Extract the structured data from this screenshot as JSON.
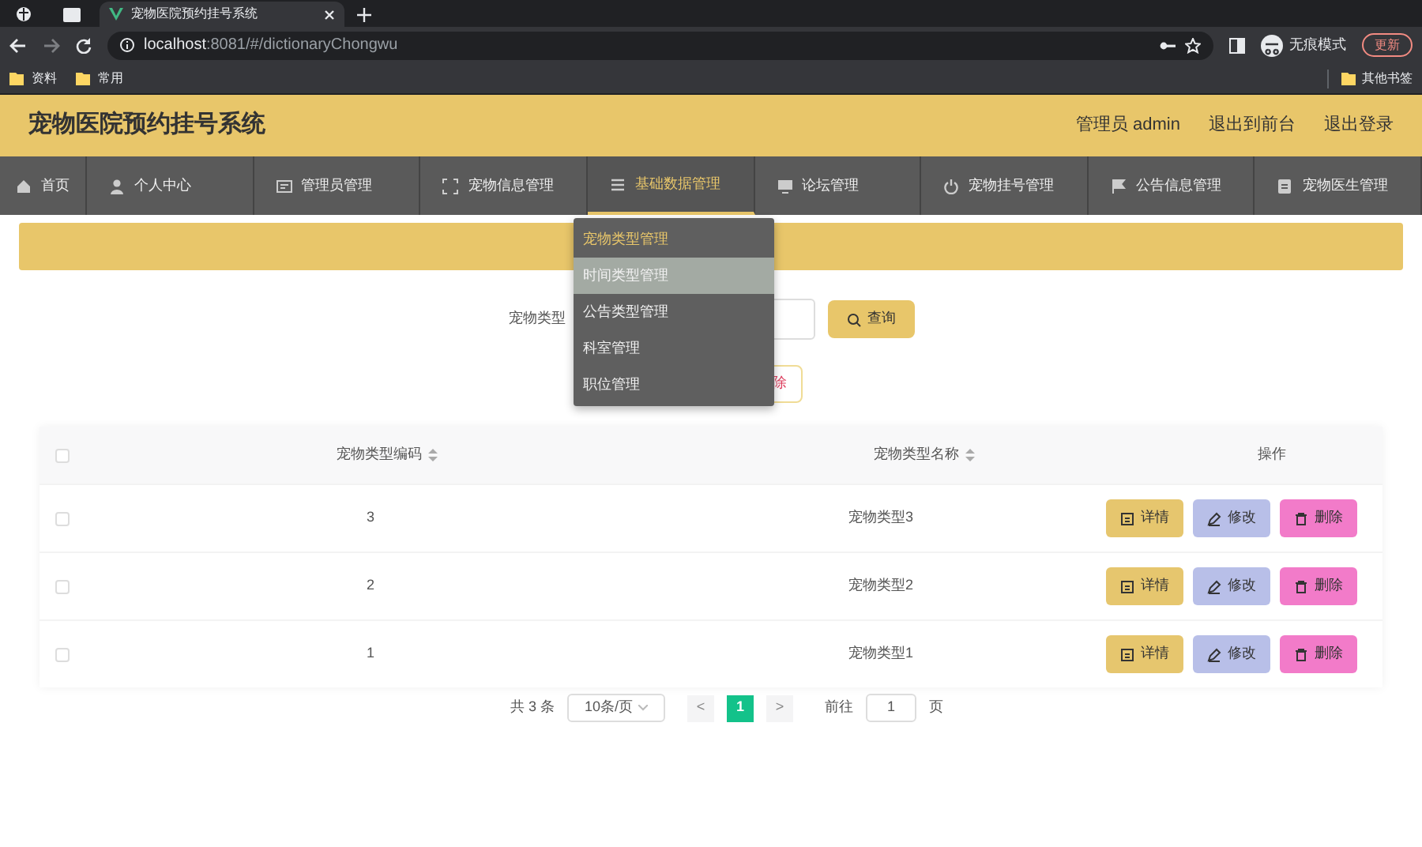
{
  "browser": {
    "tab_title": "宠物医院预约挂号系统",
    "url_host": "localhost",
    "url_rest": ":8081/#/dictionaryChongwu",
    "profile": "无痕模式",
    "update": "更新",
    "bookmarks": [
      "资料",
      "常用"
    ],
    "other_bookmarks": "其他书签"
  },
  "header": {
    "title": "宠物医院预约挂号系统",
    "user": "管理员 admin",
    "links": [
      "退出到前台",
      "退出登录"
    ]
  },
  "nav": [
    {
      "label": "首页",
      "kind": "home",
      "selected": false
    },
    {
      "label": "个人中心",
      "kind": "user",
      "selected": false
    },
    {
      "label": "管理员管理",
      "kind": "card",
      "selected": false
    },
    {
      "label": "宠物信息管理",
      "kind": "frame",
      "selected": false
    },
    {
      "label": "基础数据管理",
      "kind": "list",
      "selected": true
    },
    {
      "label": "论坛管理",
      "kind": "monitor",
      "selected": false
    },
    {
      "label": "宠物挂号管理",
      "kind": "power",
      "selected": false
    },
    {
      "label": "公告信息管理",
      "kind": "flag",
      "selected": false
    },
    {
      "label": "宠物医生管理",
      "kind": "doc",
      "selected": false
    }
  ],
  "dropdown": [
    {
      "label": "宠物类型管理",
      "selected": true,
      "hovered": false
    },
    {
      "label": "时间类型管理",
      "selected": false,
      "hovered": true
    },
    {
      "label": "公告类型管理",
      "selected": false,
      "hovered": false
    },
    {
      "label": "科室管理",
      "selected": false,
      "hovered": false
    },
    {
      "label": "职位管理",
      "selected": false,
      "hovered": false
    }
  ],
  "search": {
    "label": "宠物类型",
    "button": "查询"
  },
  "partial_button": "除",
  "table": {
    "columns": [
      "宠物类型编码",
      "宠物类型名称",
      "操作"
    ],
    "all_checked": false,
    "rows": [
      {
        "code": "3",
        "name": "宠物类型3",
        "checked": false,
        "actions": [
          {
            "label": "详情",
            "kind": "detail"
          },
          {
            "label": "修改",
            "kind": "edit"
          },
          {
            "label": "删除",
            "kind": "delete"
          }
        ]
      },
      {
        "code": "2",
        "name": "宠物类型2",
        "checked": false,
        "actions": [
          {
            "label": "详情",
            "kind": "detail"
          },
          {
            "label": "修改",
            "kind": "edit"
          },
          {
            "label": "删除",
            "kind": "delete"
          }
        ]
      },
      {
        "code": "1",
        "name": "宠物类型1",
        "checked": false,
        "actions": [
          {
            "label": "详情",
            "kind": "detail"
          },
          {
            "label": "修改",
            "kind": "edit"
          },
          {
            "label": "删除",
            "kind": "delete"
          }
        ]
      }
    ]
  },
  "pagination": {
    "total": "共 3 条",
    "page_size": "10条/页",
    "prev": "<",
    "pages": [
      {
        "label": "1",
        "selected": true
      }
    ],
    "next": ">",
    "goto": "前往",
    "goto_value": "1",
    "page_unit": "页"
  }
}
